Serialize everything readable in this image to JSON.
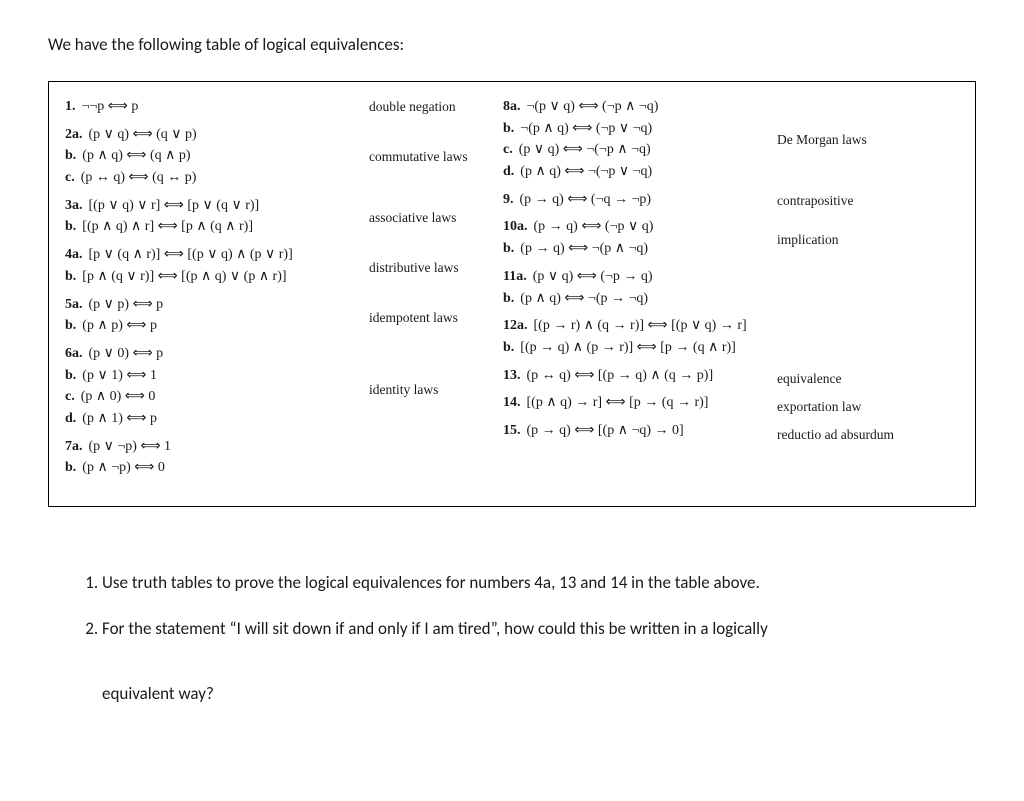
{
  "intro": "We have the following table of logical equivalences:",
  "left_groups": [
    {
      "name": "double negation",
      "rows": [
        {
          "num": "1.",
          "expr": "¬¬p ⟺ p"
        }
      ]
    },
    {
      "name": "commutative laws",
      "rows": [
        {
          "num": "2a.",
          "expr": "(p ∨ q) ⟺ (q ∨ p)"
        },
        {
          "num": "b.",
          "expr": "(p ∧ q) ⟺ (q ∧ p)"
        },
        {
          "num": "c.",
          "expr": "(p ↔ q) ⟺ (q ↔ p)"
        }
      ]
    },
    {
      "name": "associative laws",
      "rows": [
        {
          "num": "3a.",
          "expr": "[(p ∨ q) ∨ r] ⟺ [p ∨ (q ∨ r)]"
        },
        {
          "num": "b.",
          "expr": "[(p ∧ q) ∧ r] ⟺ [p ∧ (q ∧ r)]"
        }
      ]
    },
    {
      "name": "distributive laws",
      "rows": [
        {
          "num": "4a.",
          "expr": "[p ∨ (q ∧ r)] ⟺ [(p ∨ q) ∧ (p ∨ r)]"
        },
        {
          "num": "b.",
          "expr": "[p ∧ (q ∨ r)] ⟺ [(p ∧ q) ∨ (p ∧ r)]"
        }
      ]
    },
    {
      "name": "idempotent laws",
      "rows": [
        {
          "num": "5a.",
          "expr": "(p ∨ p) ⟺ p"
        },
        {
          "num": "b.",
          "expr": "(p ∧ p) ⟺ p"
        }
      ]
    },
    {
      "name": "identity laws",
      "rows": [
        {
          "num": "6a.",
          "expr": "(p ∨ 0) ⟺ p"
        },
        {
          "num": "b.",
          "expr": "(p ∨ 1) ⟺ 1"
        },
        {
          "num": "c.",
          "expr": "(p ∧ 0) ⟺ 0"
        },
        {
          "num": "d.",
          "expr": "(p ∧ 1) ⟺ p"
        }
      ]
    },
    {
      "name": "",
      "rows": [
        {
          "num": "7a.",
          "expr": "(p ∨ ¬p) ⟺ 1"
        },
        {
          "num": "b.",
          "expr": "(p ∧ ¬p) ⟺ 0"
        }
      ]
    }
  ],
  "right_groups": [
    {
      "name": "De Morgan laws",
      "rows": [
        {
          "num": "8a.",
          "expr": "¬(p ∨ q) ⟺ (¬p ∧ ¬q)"
        },
        {
          "num": "b.",
          "expr": "¬(p ∧ q) ⟺ (¬p ∨ ¬q)"
        },
        {
          "num": "c.",
          "expr": "(p ∨ q) ⟺ ¬(¬p ∧ ¬q)"
        },
        {
          "num": "d.",
          "expr": "(p ∧ q) ⟺ ¬(¬p ∨ ¬q)"
        }
      ]
    },
    {
      "name": "contrapositive",
      "rows": [
        {
          "num": "9.",
          "expr": "(p → q) ⟺ (¬q → ¬p)"
        }
      ]
    },
    {
      "name": "implication",
      "rows": [
        {
          "num": "10a.",
          "expr": "(p → q) ⟺ (¬p ∨ q)"
        },
        {
          "num": "b.",
          "expr": "(p → q) ⟺ ¬(p ∧ ¬q)"
        }
      ]
    },
    {
      "name": "",
      "rows": [
        {
          "num": "11a.",
          "expr": "(p ∨ q) ⟺ (¬p → q)"
        },
        {
          "num": "b.",
          "expr": "(p ∧ q) ⟺ ¬(p → ¬q)"
        }
      ]
    },
    {
      "name": "",
      "rows": [
        {
          "num": "12a.",
          "expr": "[(p → r) ∧ (q → r)] ⟺ [(p ∨ q) → r]"
        },
        {
          "num": "b.",
          "expr": "[(p → q) ∧ (p → r)] ⟺ [p → (q ∧ r)]"
        }
      ]
    },
    {
      "name": "equivalence",
      "rows": [
        {
          "num": "13.",
          "expr": "(p ↔ q) ⟺ [(p → q) ∧ (q → p)]"
        }
      ]
    },
    {
      "name": "exportation law",
      "rows": [
        {
          "num": "14.",
          "expr": "[(p ∧ q) → r] ⟺ [p → (q → r)]"
        }
      ]
    },
    {
      "name": "reductio ad absurdum",
      "rows": [
        {
          "num": "15.",
          "expr": "(p → q) ⟺ [(p ∧ ¬q) → 0]"
        }
      ]
    }
  ],
  "questions": {
    "q1": "Use truth tables to prove the logical equivalences for numbers 4a, 13 and 14 in the table above.",
    "q2_line1": "For the statement “I will sit down if and only if I am tired”, how could this be written in a logically",
    "q2_line2": "equivalent way?"
  }
}
